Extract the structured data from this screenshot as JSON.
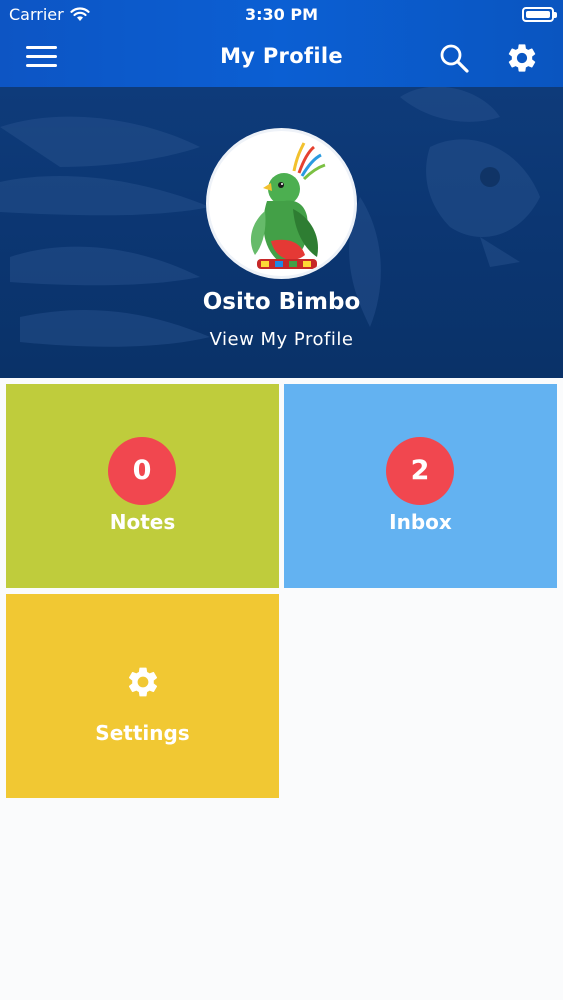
{
  "status_bar": {
    "carrier": "Carrier",
    "time": "3:30 PM",
    "wifi_icon": "wifi-icon",
    "battery_icon": "battery-icon"
  },
  "nav": {
    "title": "My Profile",
    "menu_icon": "hamburger-menu-icon",
    "search_icon": "search-icon",
    "settings_icon": "gear-icon"
  },
  "profile": {
    "name": "Osito Bimbo",
    "view_link": "View My Profile",
    "avatar_icon": "quetzal-bird-avatar"
  },
  "tiles": [
    {
      "label": "Notes",
      "count": "0",
      "color": "#bfcc3c"
    },
    {
      "label": "Inbox",
      "count": "2",
      "color": "#63b2f1"
    },
    {
      "label": "Settings",
      "icon": "gear-icon",
      "color": "#f1c833"
    }
  ],
  "colors": {
    "header": "#0b5fd3",
    "banner": "#0b3570",
    "badge": "#f1474f"
  }
}
